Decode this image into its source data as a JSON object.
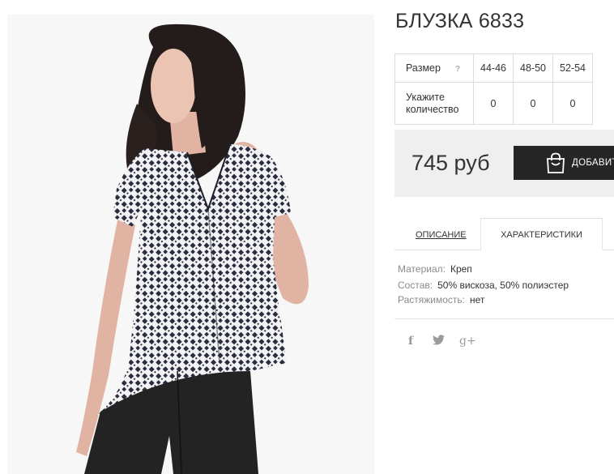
{
  "product": {
    "title": "БЛУЗКА 6833",
    "price": "745 руб"
  },
  "size_table": {
    "size_label": "Размер",
    "help_glyph": "?",
    "sizes": [
      "44-46",
      "48-50",
      "52-54"
    ],
    "qty_label_line1": "Укажите",
    "qty_label_line2": "количество",
    "quantities": [
      "0",
      "0",
      "0"
    ]
  },
  "cart": {
    "add_label": "ДОБАВИТЬ"
  },
  "tabs": {
    "description": "ОПИСАНИЕ",
    "characteristics": "ХАРАКТЕРИСТИКИ"
  },
  "specs": [
    {
      "key": "Материал:",
      "value": "Креп"
    },
    {
      "key": "Состав:",
      "value": "50% вискоза, 50% полиэстер"
    },
    {
      "key": "Растяжимость:",
      "value": "нет"
    }
  ],
  "social": {
    "facebook": "f",
    "twitter": "🐦",
    "googleplus": "g+"
  },
  "colors": {
    "button_bg": "#262626",
    "price_box_bg": "#efefef",
    "blouse_pattern": "#2a2d3e",
    "pants": "#232323"
  }
}
